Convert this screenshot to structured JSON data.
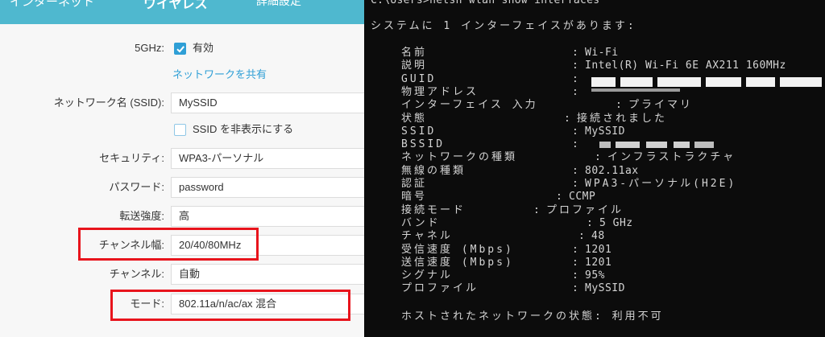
{
  "router": {
    "nav": {
      "internet": "インターネット",
      "wireless": "ワイヤレス",
      "advanced": "詳細設定"
    },
    "band": {
      "label": "5GHz:",
      "enable_text": "有効",
      "enabled": true
    },
    "share_link": "ネットワークを共有",
    "ssid": {
      "label": "ネットワーク名 (SSID):",
      "value": "MySSID"
    },
    "hide_ssid": {
      "text": "SSID を非表示にする",
      "checked": false
    },
    "security": {
      "label": "セキュリティ:",
      "value": "WPA3-パーソナル"
    },
    "password": {
      "label": "パスワード:",
      "value": "password"
    },
    "tx_power": {
      "label": "転送強度:",
      "value": "高"
    },
    "channel_width": {
      "label": "チャンネル幅:",
      "value": "20/40/80MHz"
    },
    "channel": {
      "label": "チャンネル:",
      "value": "自動"
    },
    "mode": {
      "label": "モード:",
      "value": "802.11a/n/ac/ax 混合"
    },
    "colors": {
      "accent": "#2f9fd6",
      "topbar": "#4fb8cf",
      "highlight": "#e8141c"
    }
  },
  "terminal": {
    "command": "C:\\Users>netsh wlan show interfaces",
    "summary": "システムに 1 インターフェイスがあります:",
    "rows": [
      {
        "key": "名前",
        "sep": ":",
        "value": "Wi-Fi"
      },
      {
        "key": "説明",
        "sep": ":",
        "value": "Intel(R) Wi-Fi 6E AX211 160MHz"
      },
      {
        "key": "GUID",
        "sep": ":",
        "value": ""
      },
      {
        "key": "物理アドレス",
        "sep": ":",
        "value": ""
      },
      {
        "key": "インターフェイス 入力",
        "sep": ":",
        "value": "プライマリ"
      },
      {
        "key": "状態",
        "sep": ":",
        "value": "接続されました"
      },
      {
        "key": "SSID",
        "sep": ":",
        "value": "MySSID"
      },
      {
        "key": "BSSID",
        "sep": ":",
        "value": ""
      },
      {
        "key": "ネットワークの種類",
        "sep": ":",
        "value": "インフラストラクチャ"
      },
      {
        "key": "無線の種類",
        "sep": ":",
        "value": "802.11ax"
      },
      {
        "key": "認証",
        "sep": ":",
        "value": "WPA3-パーソナル(H2E)"
      },
      {
        "key": "暗号",
        "sep": ":",
        "value": "CCMP"
      },
      {
        "key": "接続モード",
        "sep": ":",
        "value": "プロファイル"
      },
      {
        "key": "バンド",
        "sep": ":",
        "value": "5 GHz"
      },
      {
        "key": "チャネル",
        "sep": ":",
        "value": "48"
      },
      {
        "key": "受信速度 (Mbps)",
        "sep": ":",
        "value": "1201"
      },
      {
        "key": "送信速度 (Mbps)",
        "sep": ":",
        "value": "1201"
      },
      {
        "key": "シグナル",
        "sep": ":",
        "value": "95%"
      },
      {
        "key": "プロファイル",
        "sep": ":",
        "value": "MySSID"
      }
    ],
    "hosted_network": "ホストされたネットワークの状態: 利用不可"
  }
}
